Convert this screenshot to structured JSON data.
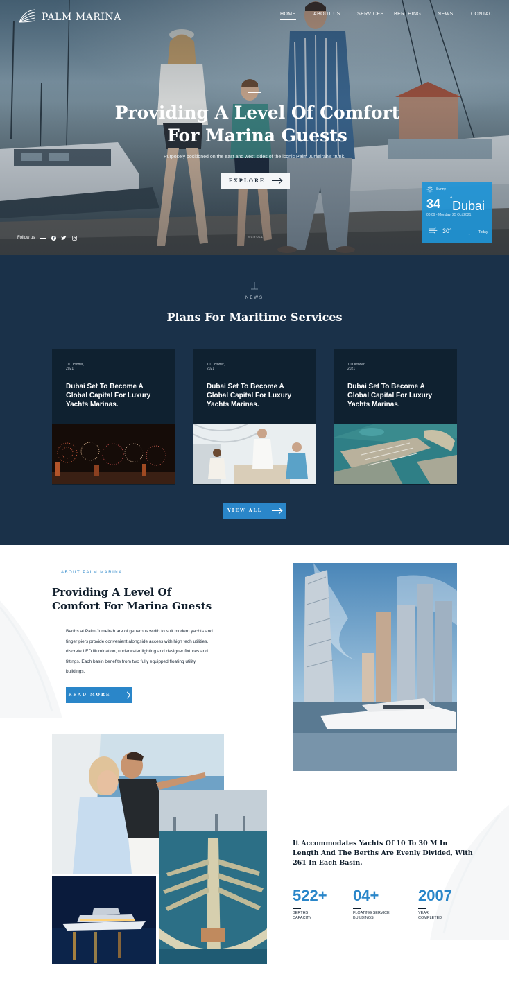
{
  "header": {
    "brand": "PALM MARINA",
    "nav": [
      {
        "label": "HOME",
        "active": true
      },
      {
        "label": "ABOUT US",
        "active": false
      },
      {
        "label": "SERVICES",
        "active": false
      },
      {
        "label": "BERTHING",
        "active": false
      },
      {
        "label": "NEWS",
        "active": false
      },
      {
        "label": "CONTACT",
        "active": false
      }
    ]
  },
  "hero": {
    "title_line1": "Providing A Level Of Comfort",
    "title_line2": "For Marina Guests",
    "subtitle": "Purposely positioned on the east and west sides of the iconic Palm Jumeirah's trunk.",
    "button_label": "EXPLORE",
    "follow_label": "Follow us",
    "social": [
      "facebook-icon",
      "twitter-icon",
      "instagram-icon"
    ],
    "scroll_label": "SCROLL"
  },
  "weather": {
    "condition": "Sunny",
    "temperature": "34",
    "degree": "°",
    "city": "Dubai",
    "datetime": "00:09 - Monday, 25 Oct 2021",
    "low_temp": "30°",
    "today": "Today",
    "accent": "#1e94d6"
  },
  "news": {
    "eyebrow": "NEWS",
    "title": "Plans For Maritime Services",
    "cards": [
      {
        "date_line1": "10 October,",
        "date_line2": "2021",
        "title": "Dubai Set To Become A Global Capital For Luxury Yachts Marinas.",
        "image": "fireworks"
      },
      {
        "date_line1": "10 October,",
        "date_line2": "2021",
        "title": "Dubai Set To Become A Global Capital For Luxury Yachts Marinas.",
        "image": "yacht-dining"
      },
      {
        "date_line1": "10 October,",
        "date_line2": "2021",
        "title": "Dubai Set To Become A Global Capital For Luxury Yachts Marinas.",
        "image": "marina-aerial"
      }
    ],
    "view_all_label": "VIEW ALL",
    "background": "#1a3149"
  },
  "about": {
    "eyebrow": "ABOUT PALM MARINA",
    "title_line1": "Providing A Level Of",
    "title_line2": "Comfort For Marina Guests",
    "body": "Berths at Palm Jumeirah are of generous width to suit modern yachts and finger piers provide convenient alongside access with high tech utilities, discrete LED illumination, underwater lighting and designer fixtures and fittings. Each basin benefits from two fully equipped floating utility buildings.",
    "button_label": "READ MORE",
    "stats_heading": "It Accommodates Yachts Of 10 To 30 M In Length And The Berths Are Evenly Divided, With 261 In Each Basin.",
    "stats": [
      {
        "value": "522+",
        "label_line1": "BERTHS",
        "label_line2": "CAPACITY"
      },
      {
        "value": "04+",
        "label_line1": "FLOATING SERVICE",
        "label_line2": "BUILDINGS"
      },
      {
        "value": "2007",
        "label_line1": "YEAR",
        "label_line2": "COMPLETED"
      }
    ],
    "accent": "#2a86c9"
  }
}
